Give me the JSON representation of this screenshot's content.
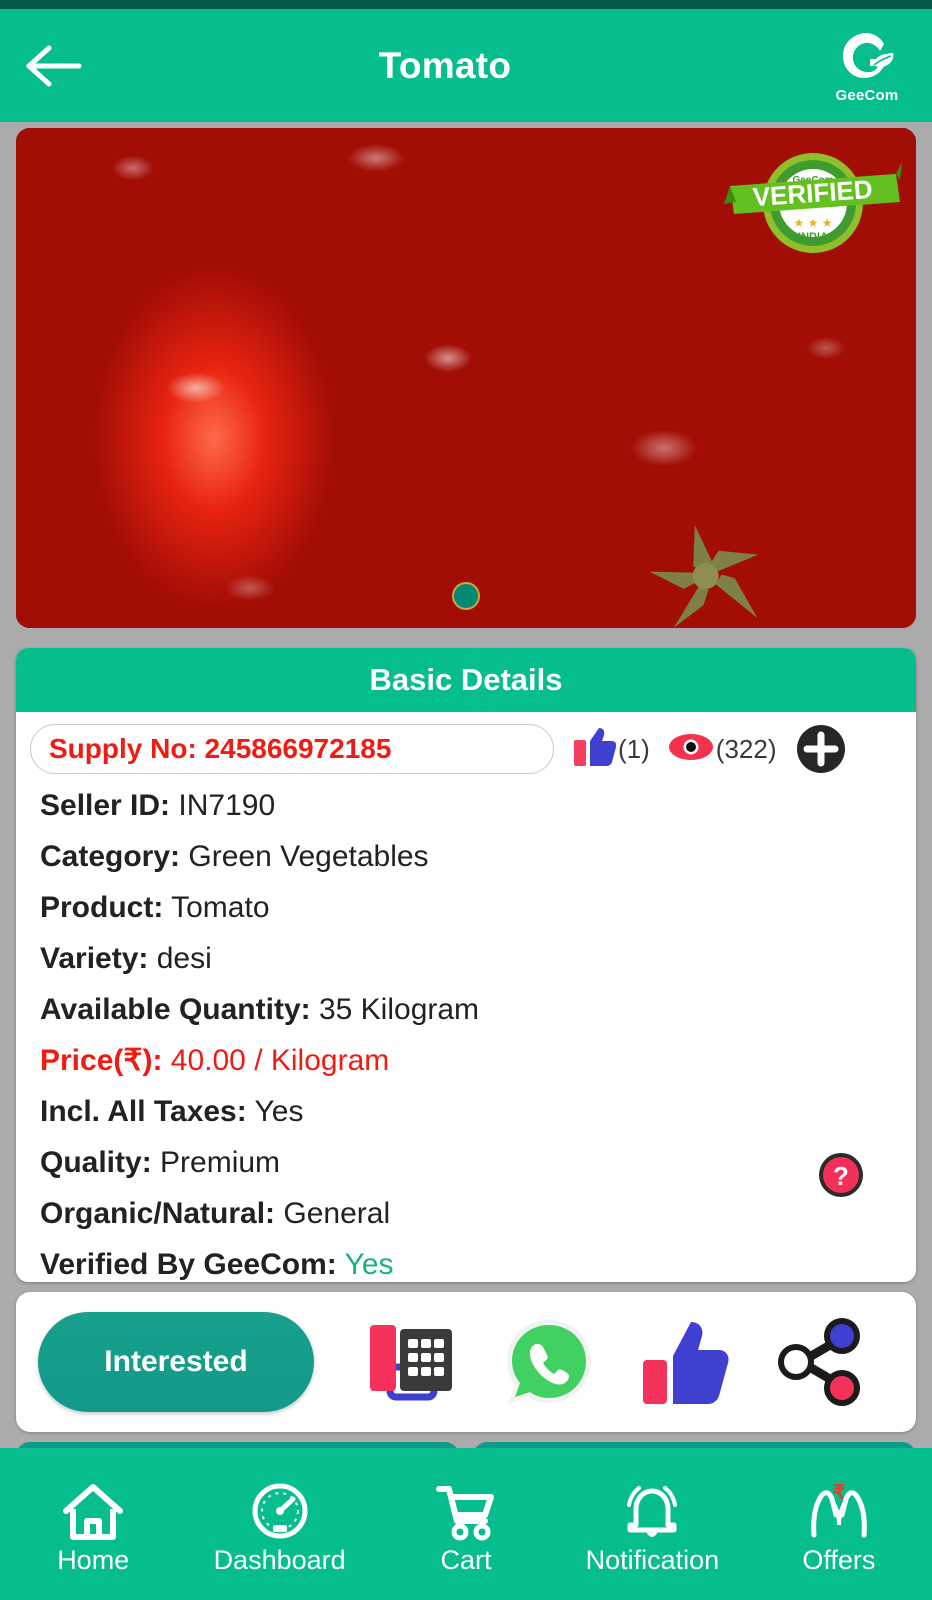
{
  "header": {
    "back_icon": "arrow-left-icon",
    "title": "Tomato",
    "brand_name": "GeeCom",
    "bg_color": "#06bd8e"
  },
  "product_image": {
    "alt": "Tomato",
    "badge": {
      "brand": "GeeCom",
      "main": "VERIFIED",
      "country": "INDIA"
    },
    "carousel_dot_color": "#068874"
  },
  "details": {
    "section_title": "Basic Details",
    "supply_no": "Supply No: 245866972185",
    "likes": "(1)",
    "views": "(322)",
    "add_icon": "plus-circle-icon",
    "help_icon": "help-question-icon",
    "rows": [
      {
        "label": "Seller ID:",
        "value": "IN7190",
        "style": "normal"
      },
      {
        "label": "Category:",
        "value": "Green Vegetables",
        "style": "normal"
      },
      {
        "label": "Product:",
        "value": "Tomato",
        "style": "normal"
      },
      {
        "label": "Variety:",
        "value": "desi",
        "style": "normal"
      },
      {
        "label": "Available Quantity:",
        "value": "35 Kilogram",
        "style": "normal"
      },
      {
        "label": "Price(₹):",
        "value": "40.00 / Kilogram",
        "style": "price"
      },
      {
        "label": "Incl. All Taxes:",
        "value": "Yes",
        "style": "normal"
      },
      {
        "label": "Quality:",
        "value": "Premium",
        "style": "normal"
      },
      {
        "label": "Organic/Natural:",
        "value": "General",
        "style": "normal"
      },
      {
        "label": "Verified By GeeCom:",
        "value": "Yes",
        "style": "verified"
      }
    ],
    "price_color": "#f01b12",
    "verified_color": "#18b27e"
  },
  "actions": {
    "interested_label": "Interested",
    "icons": [
      {
        "name": "telephone-icon"
      },
      {
        "name": "whatsapp-icon"
      },
      {
        "name": "thumbs-up-icon"
      },
      {
        "name": "share-icon"
      }
    ]
  },
  "bottom_nav": {
    "items": [
      {
        "label": "Home",
        "icon": "home-icon"
      },
      {
        "label": "Dashboard",
        "icon": "speedometer-icon"
      },
      {
        "label": "Cart",
        "icon": "shopping-cart-icon"
      },
      {
        "label": "Notification",
        "icon": "bell-icon"
      },
      {
        "label": "Offers",
        "icon": "hands-rupee-icon"
      }
    ]
  }
}
